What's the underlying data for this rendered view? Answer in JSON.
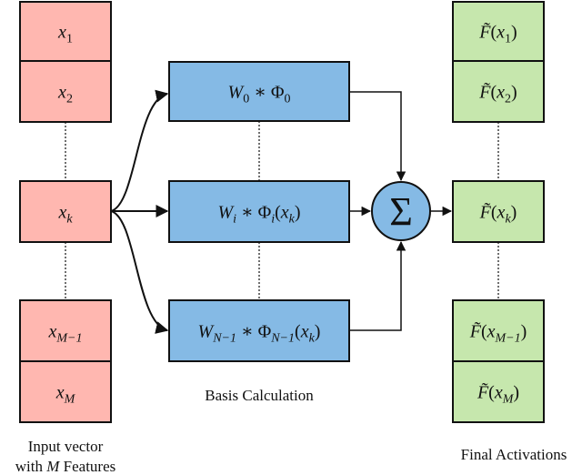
{
  "colors": {
    "input": "#ffb7b0",
    "basis": "#85bae5",
    "output": "#c6e7ad",
    "stroke": "#111111"
  },
  "input_column": {
    "caption_line1": "Input vector",
    "caption_line2_pre": "with ",
    "caption_line2_var": "M",
    "caption_line2_post": " Features",
    "cells": [
      {
        "base": "x",
        "sub": "1"
      },
      {
        "base": "x",
        "sub": "2"
      },
      {
        "base": "x",
        "sub": "k"
      },
      {
        "base": "x",
        "sub": "M−1"
      },
      {
        "base": "x",
        "sub": "M"
      }
    ]
  },
  "basis_column": {
    "caption": "Basis Calculation",
    "cells": [
      {
        "w": "W",
        "wsub": "0",
        "op": " ∗ ",
        "phi": "Φ",
        "phisub": "0",
        "arg": ""
      },
      {
        "w": "W",
        "wsub": "i",
        "op": " ∗ ",
        "phi": "Φ",
        "phisub": "i",
        "arg": "x",
        "argsub": "k"
      },
      {
        "w": "W",
        "wsub": "N−1",
        "op": " ∗ ",
        "phi": "Φ",
        "phisub": "N−1",
        "arg": "x",
        "argsub": "k"
      }
    ]
  },
  "sum_node": {
    "symbol": "Σ"
  },
  "output_column": {
    "caption": "Final Activations",
    "cells": [
      {
        "f": "F̃",
        "sub": "1"
      },
      {
        "f": "F̃",
        "sub": "2"
      },
      {
        "f": "F̃",
        "sub": "k"
      },
      {
        "f": "F̃",
        "sub": "M−1"
      },
      {
        "f": "F̃",
        "sub": "M"
      }
    ]
  }
}
